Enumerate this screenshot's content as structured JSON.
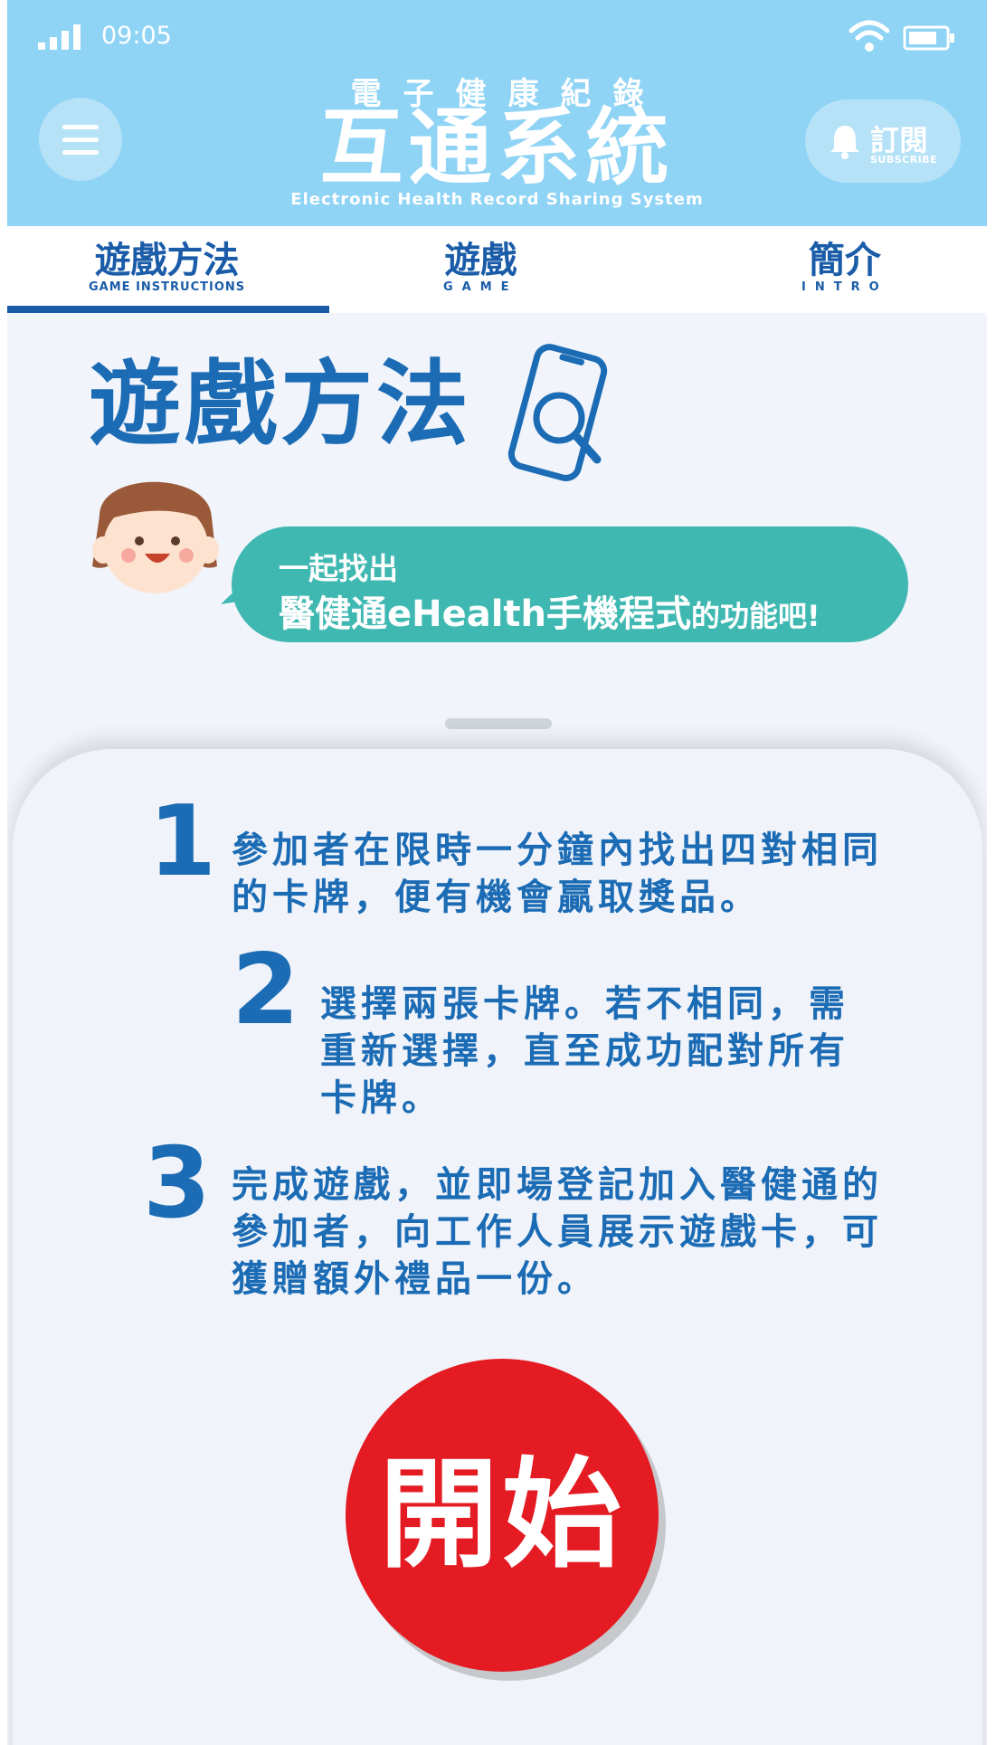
{
  "status_bar": {
    "time": "09:05",
    "icons": [
      "signal-icon",
      "wifi-icon",
      "battery-icon"
    ]
  },
  "header": {
    "title_small": "電子健康紀錄",
    "title_big": "互通系統",
    "title_en": "Electronic Health Record Sharing System",
    "menu_icon": "menu-icon",
    "subscribe": {
      "label_zh": "訂閱",
      "label_en": "SUBSCRIBE",
      "icon": "bell-icon"
    }
  },
  "tabs": [
    {
      "label": "遊戲方法",
      "sublabel": "GAME INSTRUCTIONS",
      "active": true
    },
    {
      "label": "遊戲",
      "sublabel": "GAME",
      "active": false
    },
    {
      "label": "簡介",
      "sublabel": "INTRO",
      "active": false
    }
  ],
  "main": {
    "heading": "遊戲方法",
    "heading_icon": "phone-search-icon",
    "bubble": {
      "line1": "一起找出",
      "line2_main": "醫健通eHealth手機程式",
      "line2_tail": "的功能吧!"
    },
    "steps": [
      {
        "number": "1",
        "text": "參加者在限時一分鐘內找出四對相同的卡牌，便有機會贏取獎品。"
      },
      {
        "number": "2",
        "text": "選擇兩張卡牌。若不相同，需重新選擇，直至成功配對所有卡牌。"
      },
      {
        "number": "3",
        "text": "完成遊戲，並即場登記加入醫健通的參加者，向工作人員展示遊戲卡，可獲贈額外禮品一份。"
      }
    ],
    "start_button": "開始"
  },
  "colors": {
    "header_bg": "#8fd3f5",
    "primary_blue": "#1c6cb5",
    "bubble_teal": "#40b8b2",
    "start_red": "#e41b23",
    "page_bg": "#f1f4fa"
  }
}
